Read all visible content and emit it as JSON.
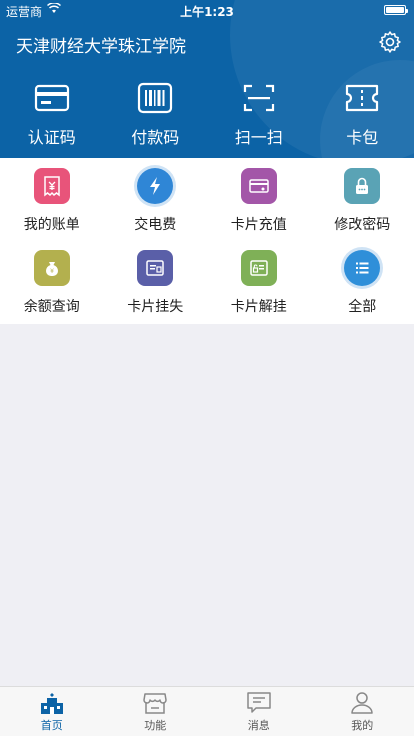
{
  "status": {
    "carrier": "运营商",
    "time": "上午1:23"
  },
  "header": {
    "title": "天津财经大学珠江学院"
  },
  "quick_actions": [
    {
      "label": "认证码",
      "icon": "card-icon"
    },
    {
      "label": "付款码",
      "icon": "barcode-icon"
    },
    {
      "label": "扫一扫",
      "icon": "scan-icon"
    },
    {
      "label": "卡包",
      "icon": "ticket-icon"
    }
  ],
  "services": [
    {
      "label": "我的账单",
      "icon": "bill-icon",
      "color": "#e8547a"
    },
    {
      "label": "交电费",
      "icon": "lightning-icon",
      "color": "#2f86d6"
    },
    {
      "label": "卡片充值",
      "icon": "card-recharge-icon",
      "color": "#a356a8"
    },
    {
      "label": "修改密码",
      "icon": "lock-icon",
      "color": "#5aa3b5"
    },
    {
      "label": "余额查询",
      "icon": "money-bag-icon",
      "color": "#b3b04e"
    },
    {
      "label": "卡片挂失",
      "icon": "card-lost-icon",
      "color": "#5a5fa8"
    },
    {
      "label": "卡片解挂",
      "icon": "card-unlock-icon",
      "color": "#7fb057"
    },
    {
      "label": "全部",
      "icon": "list-icon",
      "color": "#2f8fd9"
    }
  ],
  "tabs": [
    {
      "label": "首页",
      "icon": "home-icon"
    },
    {
      "label": "功能",
      "icon": "store-icon"
    },
    {
      "label": "消息",
      "icon": "message-icon"
    },
    {
      "label": "我的",
      "icon": "user-icon"
    }
  ],
  "colors": {
    "primary": "#0c63a6",
    "background": "#efeff4"
  }
}
